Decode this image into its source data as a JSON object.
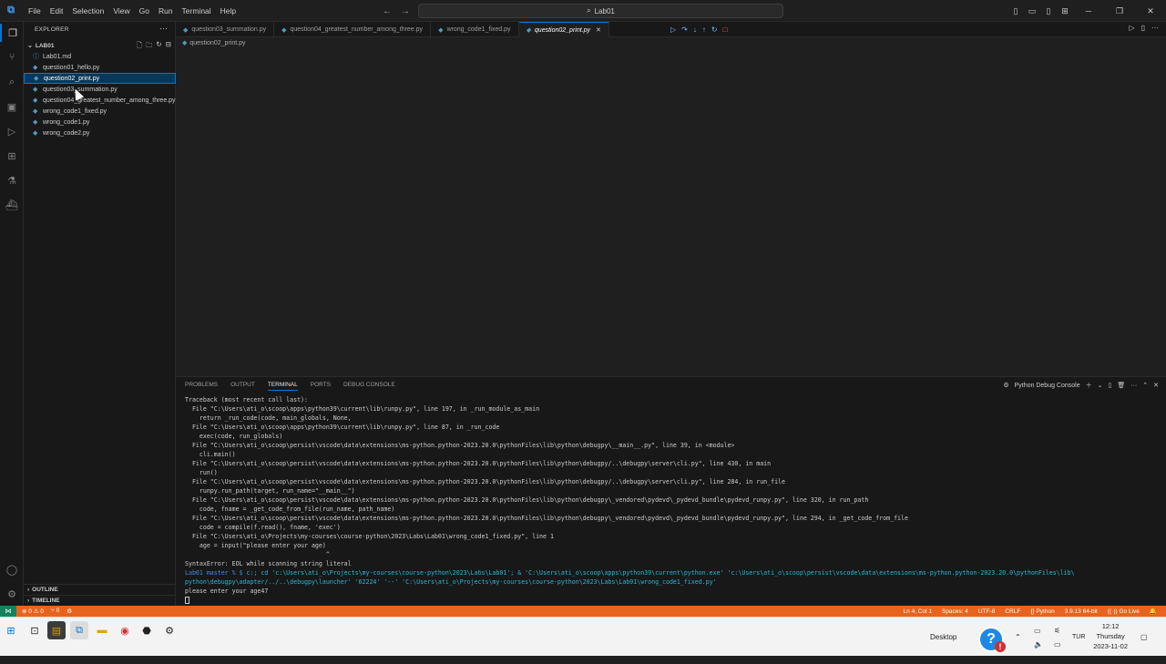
{
  "window": {
    "menu": [
      "File",
      "Edit",
      "Selection",
      "View",
      "Go",
      "Run",
      "Terminal",
      "Help"
    ],
    "command_center": "Lab01"
  },
  "sidebar": {
    "title": "EXPLORER",
    "folder": "LAB01",
    "files": [
      {
        "name": "Lab01.md",
        "type": "md",
        "selected": false
      },
      {
        "name": "question01_hello.py",
        "type": "py",
        "selected": false
      },
      {
        "name": "question02_print.py",
        "type": "py",
        "selected": true
      },
      {
        "name": "question03_summation.py",
        "type": "py",
        "selected": false
      },
      {
        "name": "question04_greatest_number_among_three.py",
        "type": "py",
        "selected": false
      },
      {
        "name": "wrong_code1_fixed.py",
        "type": "py",
        "selected": false
      },
      {
        "name": "wrong_code1.py",
        "type": "py",
        "selected": false
      },
      {
        "name": "wrong_code2.py",
        "type": "py",
        "selected": false
      }
    ],
    "outline": "OUTLINE",
    "timeline": "TIMELINE"
  },
  "tabs": [
    {
      "label": "question03_summation.py",
      "active": false
    },
    {
      "label": "question04_greatest_number_among_three.py",
      "active": false
    },
    {
      "label": "wrong_code1_fixed.py",
      "active": false
    },
    {
      "label": "question02_print.py",
      "active": true
    }
  ],
  "breadcrumb": "question02_print.py",
  "panel": {
    "tabs": [
      "PROBLEMS",
      "OUTPUT",
      "TERMINAL",
      "PORTS",
      "DEBUG CONSOLE"
    ],
    "active_tab": "TERMINAL",
    "terminal_name": "Python Debug Console",
    "lines": [
      "Traceback (most recent call last):",
      "  File \"C:\\Users\\ati_o\\scoop\\apps\\python39\\current\\lib\\runpy.py\", line 197, in _run_module_as_main",
      "    return _run_code(code, main_globals, None,",
      "  File \"C:\\Users\\ati_o\\scoop\\apps\\python39\\current\\lib\\runpy.py\", line 87, in _run_code",
      "    exec(code, run_globals)",
      "  File \"C:\\Users\\ati_o\\scoop\\persist\\vscode\\data\\extensions\\ms-python.python-2023.20.0\\pythonFiles\\lib\\python\\debugpy\\__main__.py\", line 39, in <module>",
      "    cli.main()",
      "  File \"C:\\Users\\ati_o\\scoop\\persist\\vscode\\data\\extensions\\ms-python.python-2023.20.0\\pythonFiles\\lib\\python\\debugpy/..\\debugpy\\server\\cli.py\", line 430, in main",
      "    run()",
      "  File \"C:\\Users\\ati_o\\scoop\\persist\\vscode\\data\\extensions\\ms-python.python-2023.20.0\\pythonFiles\\lib\\python\\debugpy/..\\debugpy\\server\\cli.py\", line 284, in run_file",
      "    runpy.run_path(target, run_name=\"__main__\")",
      "  File \"C:\\Users\\ati_o\\scoop\\persist\\vscode\\data\\extensions\\ms-python.python-2023.20.0\\pythonFiles\\lib\\python\\debugpy\\_vendored\\pydevd\\_pydevd_bundle\\pydevd_runpy.py\", line 320, in run_path",
      "    code, fname = _get_code_from_file(run_name, path_name)",
      "  File \"C:\\Users\\ati_o\\scoop\\persist\\vscode\\data\\extensions\\ms-python.python-2023.20.0\\pythonFiles\\lib\\python\\debugpy\\_vendored\\pydevd\\_pydevd_bundle\\pydevd_runpy.py\", line 294, in _get_code_from_file",
      "    code = compile(f.read(), fname, 'exec')",
      "  File \"C:\\Users\\ati_o\\Projects\\my-courses\\course-python\\2023\\Labs\\Lab01\\wrong_code1_fixed.py\", line 1",
      "    age = input(\"please enter your age)",
      "                                       ^",
      "SyntaxError: EOL while scanning string literal"
    ],
    "prompt_prefix": "Lab01 master % $ ",
    "command": "c:; cd 'c:\\Users\\ati_o\\Projects\\my-courses\\course-python\\2023\\Labs\\Lab01'; & 'C:\\Users\\ati_o\\scoop\\apps\\python39\\current\\python.exe' 'c:\\Users\\ati_o\\scoop\\persist\\vscode\\data\\extensions\\ms-python.python-2023.20.0\\pythonFiles\\lib\\",
    "command_cont": "python\\debugpy\\adapter/../..\\debugpy\\launcher' '62224' '--' 'C:\\Users\\ati_o\\Projects\\my-courses\\course-python\\2023\\Labs\\Lab01\\wrong_code1_fixed.py'",
    "output": "please enter your age47"
  },
  "statusbar": {
    "errors": "0",
    "warnings": "0",
    "ports": "0",
    "position": "Ln 4, Col 1",
    "spaces": "Spaces: 4",
    "encoding": "UTF-8",
    "eol": "CRLF",
    "language": "Python",
    "interpreter": "3.9.13 64-bit",
    "golive": "Go Live"
  },
  "taskbar": {
    "desktop_label": "Desktop",
    "lang": "TUR",
    "time": "12:12",
    "day": "Thursday",
    "date": "2023-11-02"
  },
  "colors": {
    "accent": "#0078d4",
    "statusbar": "#e8641e",
    "remote": "#16825d"
  }
}
